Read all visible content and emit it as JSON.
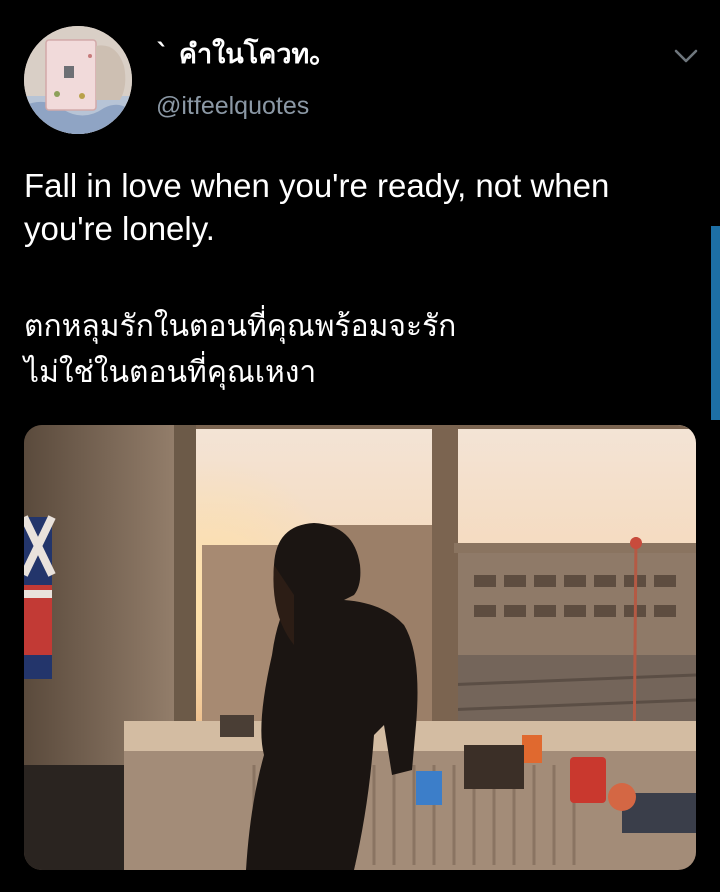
{
  "tweet": {
    "display_name": "` คำในโควท。",
    "handle": "@itfeelquotes",
    "text_en": "Fall in love when you're ready, not when you're lonely.",
    "text_th_line1": "ตกหลุมรักในตอนที่คุณพร้อมจะรัก",
    "text_th_line2": "ไม่ใช่ในตอนที่คุณเหงา"
  },
  "icons": {
    "menu": "chevron-down-icon",
    "avatar": "avatar-image"
  },
  "colors": {
    "background": "#000000",
    "text": "#ffffff",
    "handle": "#8b98a5",
    "scroll_indicator": "#1d6fa5"
  }
}
